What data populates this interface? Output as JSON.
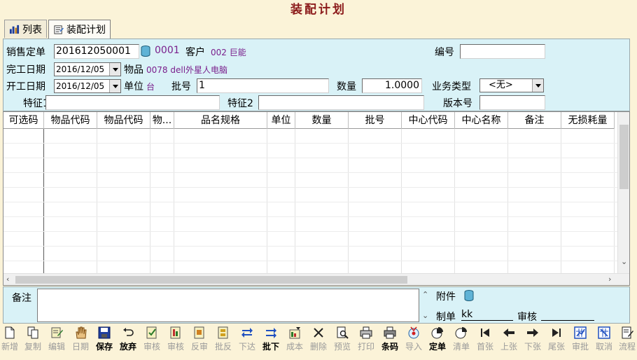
{
  "window_title": "装配计划",
  "tabs": [
    {
      "label": "列表",
      "icon": "bar-chart-icon"
    },
    {
      "label": "装配计划",
      "icon": "form-icon"
    }
  ],
  "form": {
    "sales_order_label": "销售定单",
    "sales_order_value": "201612050001",
    "sales_order_code": "0001",
    "customer_label": "客户",
    "customer_value": "002 巨能",
    "serial_label": "编号",
    "serial_value": "",
    "finish_date_label": "完工日期",
    "finish_date_value": "2016/12/05",
    "item_label": "物品",
    "item_value": "0078 dell外星人电脑",
    "start_date_label": "开工日期",
    "start_date_value": "2016/12/05",
    "unit_label": "单位",
    "unit_value": "台",
    "batch_label": "批号",
    "batch_value": "1",
    "qty_label": "数量",
    "qty_value": "1.0000",
    "biz_type_label": "业务类型",
    "biz_type_value": "<无>",
    "feature1_label": "特征1",
    "feature1_value": "",
    "feature2_label": "特征2",
    "feature2_value": "",
    "version_label": "版本号",
    "version_value": ""
  },
  "grid": {
    "columns": [
      "可选码",
      "物品代码",
      "物品代码",
      "物...",
      "品名规格",
      "单位",
      "数量",
      "批号",
      "中心代码",
      "中心名称",
      "备注",
      "无损耗量"
    ],
    "rows": []
  },
  "notes": {
    "label": "备注",
    "value": "",
    "attachment_label": "附件",
    "maker_label": "制单",
    "maker_value": "kk",
    "auditor_label": "审核",
    "auditor_value": ""
  },
  "toolbar": [
    {
      "label": "新增",
      "icon": "new-doc-icon",
      "enabled": false
    },
    {
      "label": "复制",
      "icon": "copy-icon",
      "enabled": false
    },
    {
      "label": "编辑",
      "icon": "edit-icon",
      "enabled": false
    },
    {
      "label": "日期",
      "icon": "hand-icon",
      "enabled": false
    },
    {
      "label": "保存",
      "icon": "save-icon",
      "enabled": true
    },
    {
      "label": "放弃",
      "icon": "undo-icon",
      "enabled": true
    },
    {
      "label": "审核",
      "icon": "audit-icon",
      "enabled": false
    },
    {
      "label": "审核",
      "icon": "audit2-icon",
      "enabled": false
    },
    {
      "label": "反审",
      "icon": "unaudit-icon",
      "enabled": false
    },
    {
      "label": "批反",
      "icon": "batch-unaudit-icon",
      "enabled": false
    },
    {
      "label": "下达",
      "icon": "issue-icon",
      "enabled": false
    },
    {
      "label": "批下",
      "icon": "batch-issue-icon",
      "enabled": true
    },
    {
      "label": "成本",
      "icon": "cost-icon",
      "enabled": false
    },
    {
      "label": "删除",
      "icon": "delete-icon",
      "enabled": false
    },
    {
      "label": "预览",
      "icon": "preview-icon",
      "enabled": false
    },
    {
      "label": "打印",
      "icon": "print-icon",
      "enabled": false
    },
    {
      "label": "条码",
      "icon": "barcode-printer-icon",
      "enabled": true
    },
    {
      "label": "导入",
      "icon": "import-icon",
      "enabled": false
    },
    {
      "label": "定单",
      "icon": "order-pie-icon",
      "enabled": true
    },
    {
      "label": "清单",
      "icon": "list-pie-icon",
      "enabled": false
    },
    {
      "label": "首张",
      "icon": "first-icon",
      "enabled": false
    },
    {
      "label": "上张",
      "icon": "prev-icon",
      "enabled": false
    },
    {
      "label": "下张",
      "icon": "next-icon",
      "enabled": false
    },
    {
      "label": "尾张",
      "icon": "last-icon",
      "enabled": false
    },
    {
      "label": "审批",
      "icon": "approve-icon",
      "enabled": false
    },
    {
      "label": "取消",
      "icon": "cancel-icon",
      "enabled": false
    },
    {
      "label": "流程",
      "icon": "flow-icon",
      "enabled": false
    }
  ]
}
